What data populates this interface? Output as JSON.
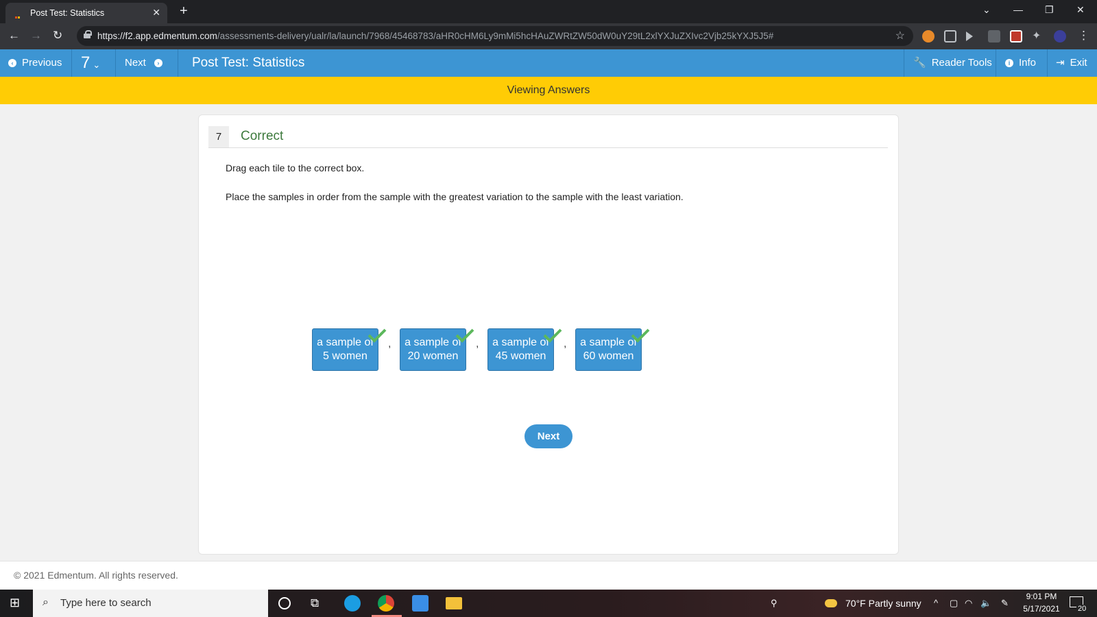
{
  "browser": {
    "tab_title": "Post Test: Statistics",
    "url_host": "https://f2.app.edmentum.com",
    "url_path": "/assessments-delivery/ualr/la/launch/7968/45468783/aHR0cHM6Ly9mMi5hcHAuZWRtZW50dW0uY29tL2xlYXJuZXIvc2Vjb25kYXJ5J5#"
  },
  "header": {
    "previous_label": "Previous",
    "question_selector": "7",
    "next_label": "Next",
    "title": "Post Test: Statistics",
    "reader_tools_label": "Reader Tools",
    "info_label": "Info",
    "exit_label": "Exit"
  },
  "banner": {
    "text": "Viewing Answers"
  },
  "question": {
    "number": "7",
    "status": "Correct",
    "instruction": "Drag each tile to the correct box.",
    "prompt": "Place the samples in order from the sample with the greatest variation to the sample with the least variation.",
    "tiles": [
      {
        "line1": "a sample of",
        "line2": "5 women"
      },
      {
        "line1": "a sample of",
        "line2": "20 women"
      },
      {
        "line1": "a sample of",
        "line2": "45 women"
      },
      {
        "line1": "a sample of",
        "line2": "60 women"
      }
    ],
    "separator": ",",
    "next_button": "Next"
  },
  "footer": {
    "copyright": "© 2021 Edmentum. All rights reserved."
  },
  "taskbar": {
    "search_placeholder": "Type here to search",
    "weather": "70°F  Partly sunny",
    "time": "9:01 PM",
    "date": "5/17/2021",
    "notifications": "20"
  },
  "colors": {
    "accent": "#3d95d3",
    "banner": "#ffcc05",
    "correct": "#3d7a3d",
    "check": "#5cb85c"
  }
}
